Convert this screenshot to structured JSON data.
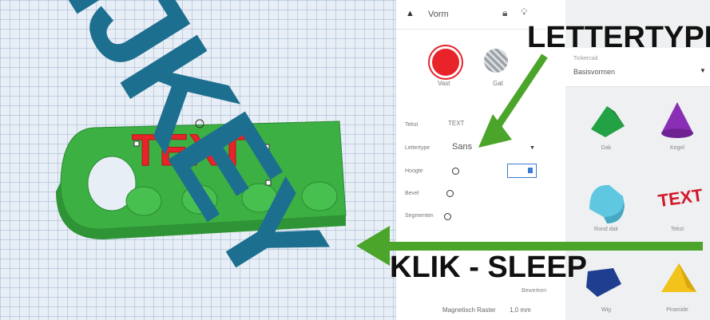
{
  "header": {
    "section_title": "Vorm",
    "lock_icon": "lock-icon",
    "light_icon": "lightbulb-icon"
  },
  "inspector": {
    "solid_label": "Vast",
    "hole_label": "Gat",
    "rows": [
      {
        "label": "Tekst",
        "value": "TEXT"
      },
      {
        "label": "Lettertype",
        "value": "Sans"
      },
      {
        "label": "Hoogte",
        "value": ""
      },
      {
        "label": "Bevel",
        "value": ""
      },
      {
        "label": "Segmenten",
        "value": ""
      }
    ],
    "solid_color": "#e8232a"
  },
  "library": {
    "category_label": "Tinkercad",
    "category_value": "Basisvormen",
    "shapes": [
      {
        "label": "Dak",
        "icon": "roof-shape-icon",
        "color": "#22a244"
      },
      {
        "label": "Kegel",
        "icon": "cone-shape-icon",
        "color": "#8a2fb5"
      },
      {
        "label": "Rond dak",
        "icon": "round-roof-shape-icon",
        "color": "#5fc8e0"
      },
      {
        "label": "Tekst",
        "icon": "text-shape-icon",
        "color": "#d3192b"
      },
      {
        "label": "Wig",
        "icon": "wedge-shape-icon",
        "color": "#1f3e8f"
      },
      {
        "label": "Piramide",
        "icon": "pyramid-shape-icon",
        "color": "#f2c31a"
      }
    ]
  },
  "footer": {
    "edit_grid_label": "Bewerken",
    "snap_grid_label": "Magnetisch Raster",
    "snap_grid_value": "1,0 mm"
  },
  "overlay": {
    "banner_text": "IJKEY",
    "banner_color": "#1d6f8f",
    "lettertype_callout": "LETTERTYPE",
    "drag_callout": "KLIK - SLEEP",
    "arrow_color": "#4aa52a"
  },
  "model": {
    "text_on_model": "TEXT",
    "keychain_color": "#3cb043",
    "text_color": "#e8232a"
  }
}
